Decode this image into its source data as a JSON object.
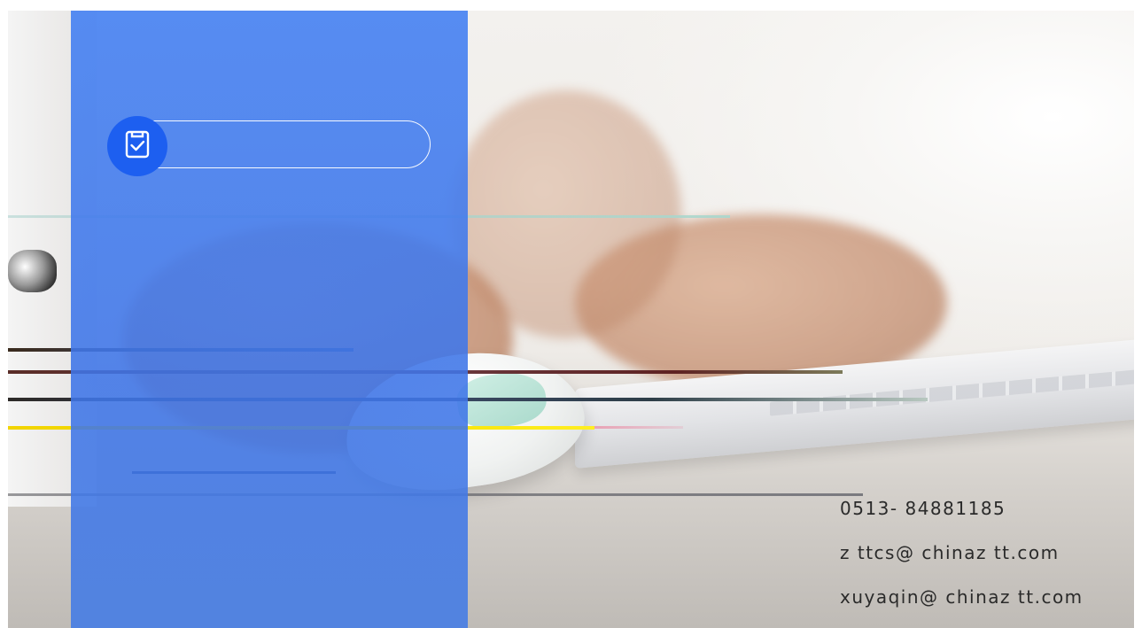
{
  "contact": {
    "phone": "0513- 84881185",
    "email_primary": "z ttcs@ chinaz tt.com",
    "email_secondary": "xuyaqin@ chinaz tt.com"
  },
  "icons": {
    "badge_icon": "clipboard-check-icon"
  },
  "colors": {
    "panel_blue": "#4a84f2",
    "icon_circle": "#1d5ff0",
    "accent_yellow": "#f5e100"
  }
}
